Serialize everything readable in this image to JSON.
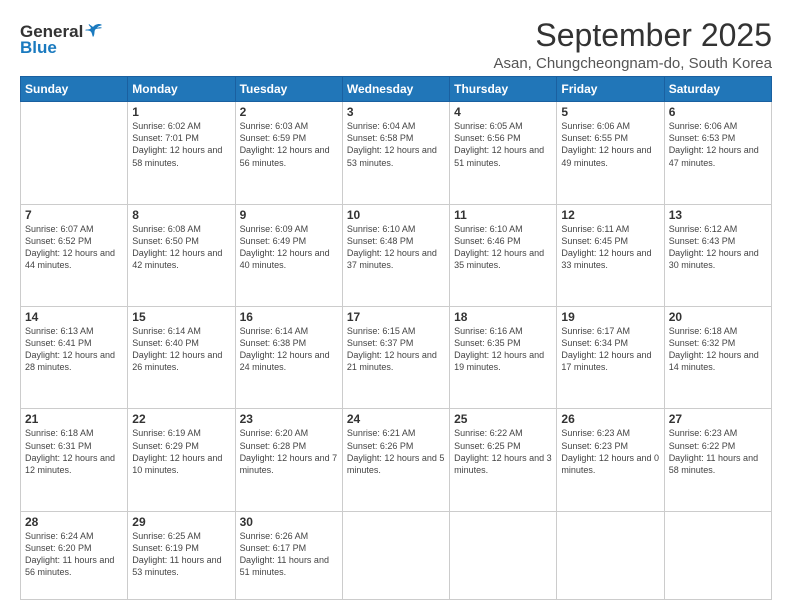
{
  "logo": {
    "general": "General",
    "blue": "Blue"
  },
  "title": "September 2025",
  "subtitle": "Asan, Chungcheongnam-do, South Korea",
  "days_of_week": [
    "Sunday",
    "Monday",
    "Tuesday",
    "Wednesday",
    "Thursday",
    "Friday",
    "Saturday"
  ],
  "weeks": [
    [
      {
        "day": "",
        "sunrise": "",
        "sunset": "",
        "daylight": ""
      },
      {
        "day": "1",
        "sunrise": "Sunrise: 6:02 AM",
        "sunset": "Sunset: 7:01 PM",
        "daylight": "Daylight: 12 hours and 58 minutes."
      },
      {
        "day": "2",
        "sunrise": "Sunrise: 6:03 AM",
        "sunset": "Sunset: 6:59 PM",
        "daylight": "Daylight: 12 hours and 56 minutes."
      },
      {
        "day": "3",
        "sunrise": "Sunrise: 6:04 AM",
        "sunset": "Sunset: 6:58 PM",
        "daylight": "Daylight: 12 hours and 53 minutes."
      },
      {
        "day": "4",
        "sunrise": "Sunrise: 6:05 AM",
        "sunset": "Sunset: 6:56 PM",
        "daylight": "Daylight: 12 hours and 51 minutes."
      },
      {
        "day": "5",
        "sunrise": "Sunrise: 6:06 AM",
        "sunset": "Sunset: 6:55 PM",
        "daylight": "Daylight: 12 hours and 49 minutes."
      },
      {
        "day": "6",
        "sunrise": "Sunrise: 6:06 AM",
        "sunset": "Sunset: 6:53 PM",
        "daylight": "Daylight: 12 hours and 47 minutes."
      }
    ],
    [
      {
        "day": "7",
        "sunrise": "Sunrise: 6:07 AM",
        "sunset": "Sunset: 6:52 PM",
        "daylight": "Daylight: 12 hours and 44 minutes."
      },
      {
        "day": "8",
        "sunrise": "Sunrise: 6:08 AM",
        "sunset": "Sunset: 6:50 PM",
        "daylight": "Daylight: 12 hours and 42 minutes."
      },
      {
        "day": "9",
        "sunrise": "Sunrise: 6:09 AM",
        "sunset": "Sunset: 6:49 PM",
        "daylight": "Daylight: 12 hours and 40 minutes."
      },
      {
        "day": "10",
        "sunrise": "Sunrise: 6:10 AM",
        "sunset": "Sunset: 6:48 PM",
        "daylight": "Daylight: 12 hours and 37 minutes."
      },
      {
        "day": "11",
        "sunrise": "Sunrise: 6:10 AM",
        "sunset": "Sunset: 6:46 PM",
        "daylight": "Daylight: 12 hours and 35 minutes."
      },
      {
        "day": "12",
        "sunrise": "Sunrise: 6:11 AM",
        "sunset": "Sunset: 6:45 PM",
        "daylight": "Daylight: 12 hours and 33 minutes."
      },
      {
        "day": "13",
        "sunrise": "Sunrise: 6:12 AM",
        "sunset": "Sunset: 6:43 PM",
        "daylight": "Daylight: 12 hours and 30 minutes."
      }
    ],
    [
      {
        "day": "14",
        "sunrise": "Sunrise: 6:13 AM",
        "sunset": "Sunset: 6:41 PM",
        "daylight": "Daylight: 12 hours and 28 minutes."
      },
      {
        "day": "15",
        "sunrise": "Sunrise: 6:14 AM",
        "sunset": "Sunset: 6:40 PM",
        "daylight": "Daylight: 12 hours and 26 minutes."
      },
      {
        "day": "16",
        "sunrise": "Sunrise: 6:14 AM",
        "sunset": "Sunset: 6:38 PM",
        "daylight": "Daylight: 12 hours and 24 minutes."
      },
      {
        "day": "17",
        "sunrise": "Sunrise: 6:15 AM",
        "sunset": "Sunset: 6:37 PM",
        "daylight": "Daylight: 12 hours and 21 minutes."
      },
      {
        "day": "18",
        "sunrise": "Sunrise: 6:16 AM",
        "sunset": "Sunset: 6:35 PM",
        "daylight": "Daylight: 12 hours and 19 minutes."
      },
      {
        "day": "19",
        "sunrise": "Sunrise: 6:17 AM",
        "sunset": "Sunset: 6:34 PM",
        "daylight": "Daylight: 12 hours and 17 minutes."
      },
      {
        "day": "20",
        "sunrise": "Sunrise: 6:18 AM",
        "sunset": "Sunset: 6:32 PM",
        "daylight": "Daylight: 12 hours and 14 minutes."
      }
    ],
    [
      {
        "day": "21",
        "sunrise": "Sunrise: 6:18 AM",
        "sunset": "Sunset: 6:31 PM",
        "daylight": "Daylight: 12 hours and 12 minutes."
      },
      {
        "day": "22",
        "sunrise": "Sunrise: 6:19 AM",
        "sunset": "Sunset: 6:29 PM",
        "daylight": "Daylight: 12 hours and 10 minutes."
      },
      {
        "day": "23",
        "sunrise": "Sunrise: 6:20 AM",
        "sunset": "Sunset: 6:28 PM",
        "daylight": "Daylight: 12 hours and 7 minutes."
      },
      {
        "day": "24",
        "sunrise": "Sunrise: 6:21 AM",
        "sunset": "Sunset: 6:26 PM",
        "daylight": "Daylight: 12 hours and 5 minutes."
      },
      {
        "day": "25",
        "sunrise": "Sunrise: 6:22 AM",
        "sunset": "Sunset: 6:25 PM",
        "daylight": "Daylight: 12 hours and 3 minutes."
      },
      {
        "day": "26",
        "sunrise": "Sunrise: 6:23 AM",
        "sunset": "Sunset: 6:23 PM",
        "daylight": "Daylight: 12 hours and 0 minutes."
      },
      {
        "day": "27",
        "sunrise": "Sunrise: 6:23 AM",
        "sunset": "Sunset: 6:22 PM",
        "daylight": "Daylight: 11 hours and 58 minutes."
      }
    ],
    [
      {
        "day": "28",
        "sunrise": "Sunrise: 6:24 AM",
        "sunset": "Sunset: 6:20 PM",
        "daylight": "Daylight: 11 hours and 56 minutes."
      },
      {
        "day": "29",
        "sunrise": "Sunrise: 6:25 AM",
        "sunset": "Sunset: 6:19 PM",
        "daylight": "Daylight: 11 hours and 53 minutes."
      },
      {
        "day": "30",
        "sunrise": "Sunrise: 6:26 AM",
        "sunset": "Sunset: 6:17 PM",
        "daylight": "Daylight: 11 hours and 51 minutes."
      },
      {
        "day": "",
        "sunrise": "",
        "sunset": "",
        "daylight": ""
      },
      {
        "day": "",
        "sunrise": "",
        "sunset": "",
        "daylight": ""
      },
      {
        "day": "",
        "sunrise": "",
        "sunset": "",
        "daylight": ""
      },
      {
        "day": "",
        "sunrise": "",
        "sunset": "",
        "daylight": ""
      }
    ]
  ]
}
